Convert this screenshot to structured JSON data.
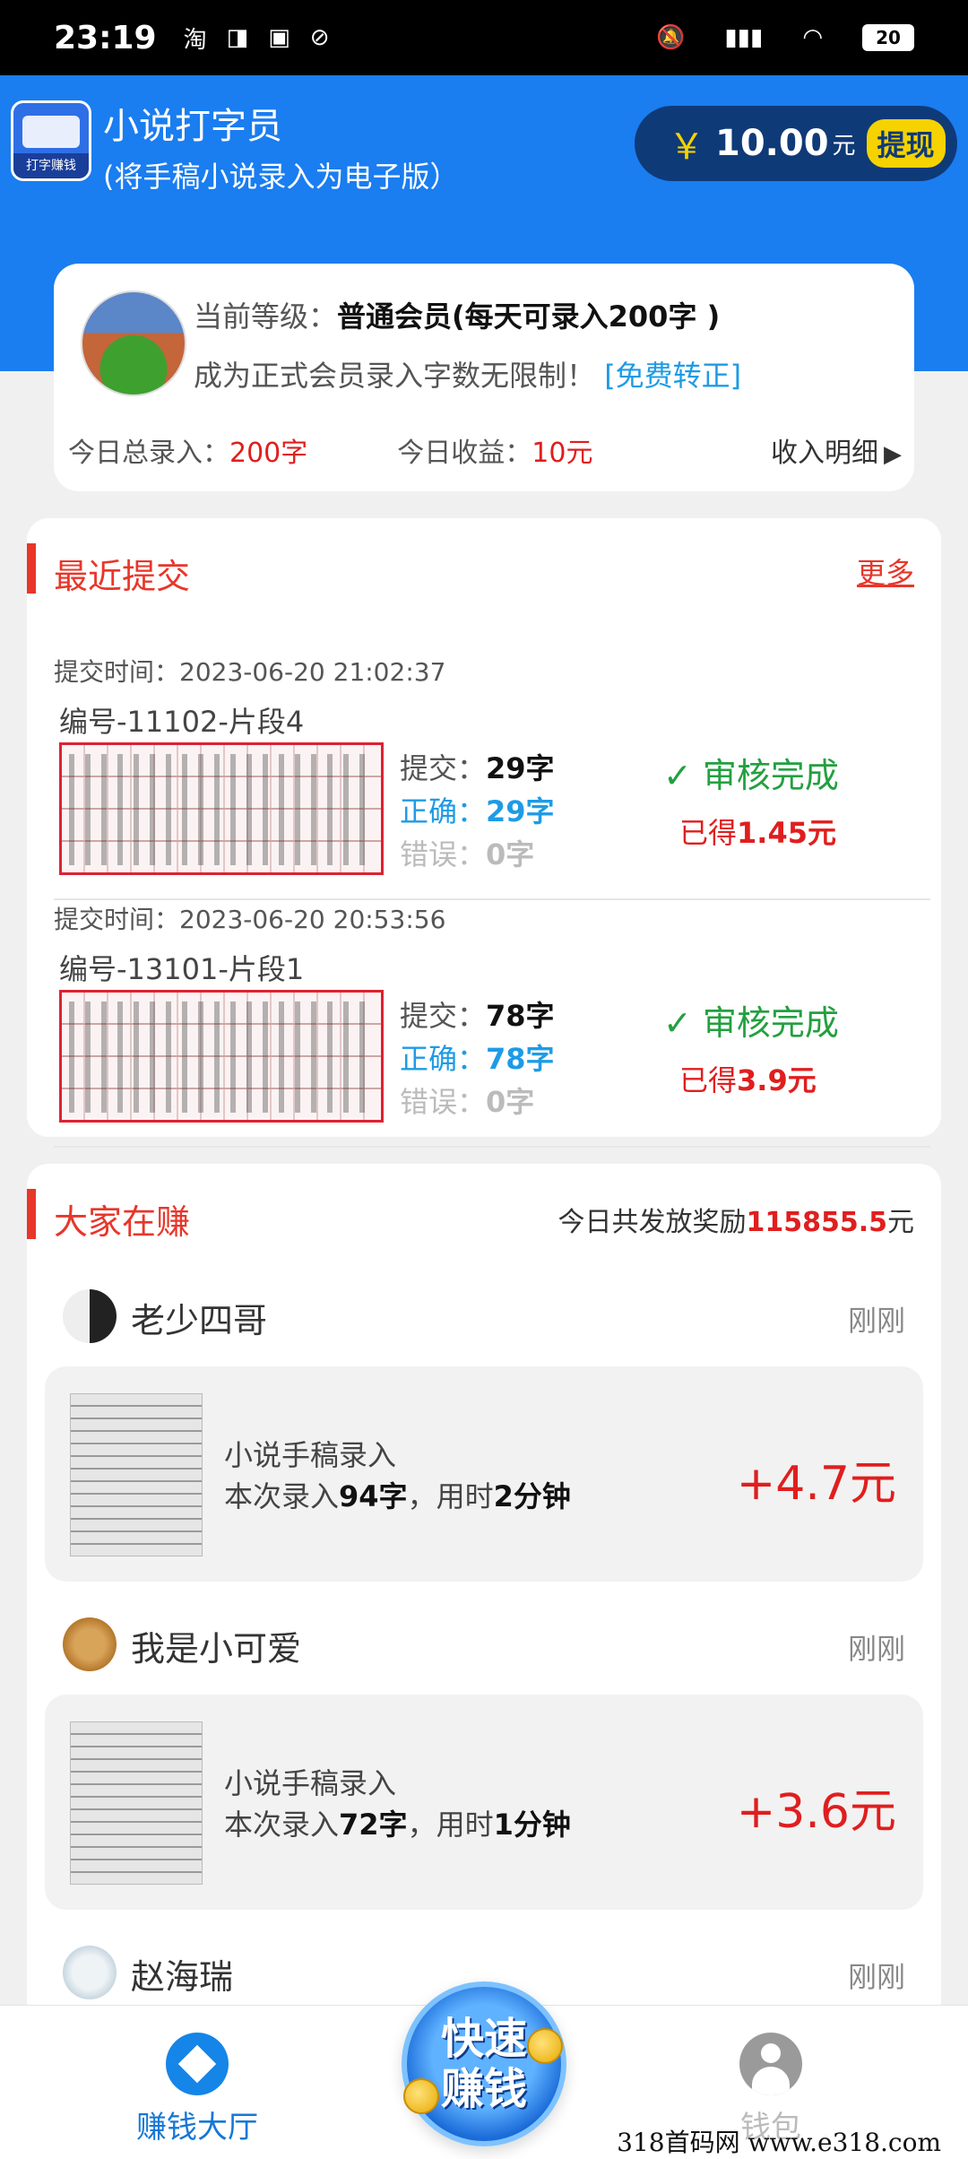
{
  "status_bar": {
    "time": "23:19",
    "notif_icons": [
      "淘",
      "◨",
      "▣",
      "⊘"
    ],
    "battery": "20"
  },
  "app": {
    "logo_tag": "打字赚钱",
    "title": "小说打字员",
    "subtitle": "(将手稿小说录入为电子版）",
    "balance_symbol": "￥",
    "balance_amount": "10.00",
    "balance_unit": "元",
    "withdraw_label": "提现"
  },
  "member": {
    "level_label": "当前等级：",
    "level_value": "普通会员(每天可录入200字 )",
    "promo_text": "成为正式会员录入字数无限制！",
    "promo_link": "[免费转正]",
    "today_total_label": "今日总录入：",
    "today_total_value": "200字",
    "today_income_label": "今日收益：",
    "today_income_value": "10元",
    "detail_label": "收入明细"
  },
  "recent": {
    "title": "最近提交",
    "more": "更多",
    "items": [
      {
        "time": "提交时间：2023-06-20  21:02:37",
        "code": "编号-11102-片段4",
        "submit_label": "提交：",
        "submit_value": "29字",
        "correct_label": "正确：",
        "correct_value": "29字",
        "error_label": "错误：",
        "error_value": "0字",
        "status": "审核完成",
        "earned_label": "已得",
        "earned_value": "1.45元"
      },
      {
        "time": "提交时间：2023-06-20  20:53:56",
        "code": "编号-13101-片段1",
        "submit_label": "提交：",
        "submit_value": "78字",
        "correct_label": "正确：",
        "correct_value": "78字",
        "error_label": "错误：",
        "error_value": "0字",
        "status": "审核完成",
        "earned_label": "已得",
        "earned_value": "3.9元"
      }
    ]
  },
  "feed": {
    "title": "大家在赚",
    "payout_prefix": "今日共发放奖励",
    "payout_value": "115855.5",
    "payout_unit": "元",
    "items": [
      {
        "name": "老少四哥",
        "time": "刚刚",
        "card_title": "小说手稿录入",
        "desc_a": "本次录入",
        "desc_chars": "94字",
        "desc_b": "，用时",
        "desc_duration": "2分钟",
        "reward": "+4.7元"
      },
      {
        "name": "我是小可爱",
        "time": "刚刚",
        "card_title": "小说手稿录入",
        "desc_a": "本次录入",
        "desc_chars": "72字",
        "desc_b": "，用时",
        "desc_duration": "1分钟",
        "reward": "+3.6元"
      },
      {
        "name": "赵海瑞",
        "time": "刚刚"
      }
    ]
  },
  "nav": {
    "home": "赚钱大厅",
    "quick_earn_line1": "快速",
    "quick_earn_line2": "赚钱",
    "wallet": "钱包"
  },
  "watermark": "318首码网  www.e318.com",
  "colors": {
    "brand_blue": "#1a7df0",
    "accent_red": "#e8362a",
    "success_green": "#23a040",
    "info_blue": "#1e9be6"
  }
}
